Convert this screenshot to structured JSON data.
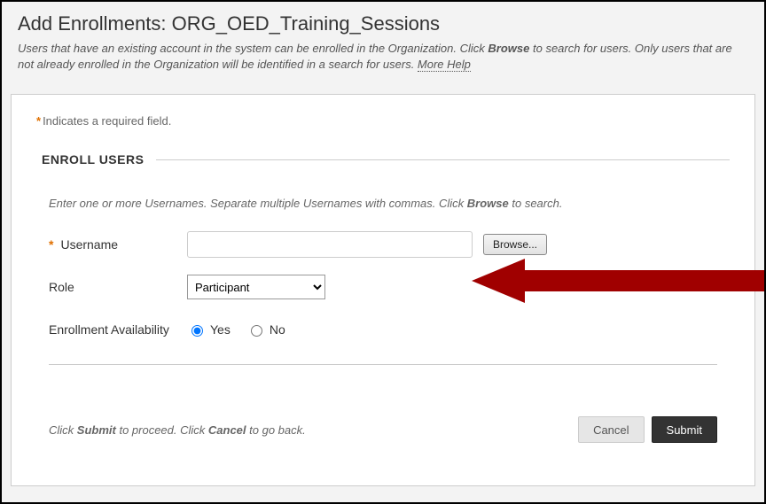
{
  "header": {
    "title": "Add Enrollments: ORG_OED_Training_Sessions",
    "desc_pre": "Users that have an existing account in the system can be enrolled in the Organization. Click ",
    "desc_browse": "Browse",
    "desc_post": " to search for users. Only users that are not already enrolled in the Organization will be identified in a search for users. ",
    "more_help": "More Help"
  },
  "panel": {
    "required_note": "Indicates a required field.",
    "section_title": "ENROLL USERS",
    "instructions_pre": "Enter one or more Usernames. Separate multiple Usernames with commas. Click ",
    "instructions_browse": "Browse",
    "instructions_post": " to search.",
    "fields": {
      "username_label": "Username",
      "browse_btn": "Browse...",
      "role_label": "Role",
      "role_value": "Participant",
      "availability_label": "Enrollment Availability",
      "yes": "Yes",
      "no": "No"
    },
    "footer": {
      "text_pre": "Click ",
      "submit_word": "Submit",
      "text_mid": " to proceed. Click ",
      "cancel_word": "Cancel",
      "text_post": " to go back.",
      "cancel_btn": "Cancel",
      "submit_btn": "Submit"
    }
  }
}
